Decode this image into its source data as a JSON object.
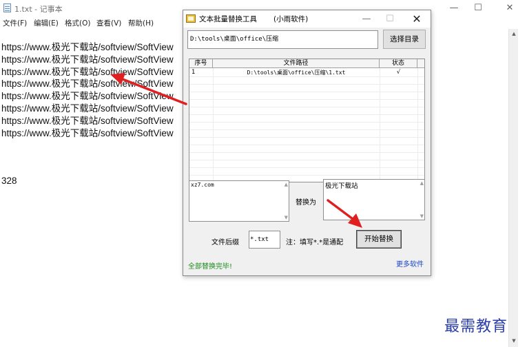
{
  "notepad": {
    "title": "1.txt - 记事本",
    "controls": {
      "minimize": "—",
      "maximize": "☐",
      "close": "✕"
    },
    "menu": [
      "文件(F)",
      "编辑(E)",
      "格式(O)",
      "查看(V)",
      "帮助(H)"
    ],
    "lines": [
      "https://www.极光下载站/softview/SoftView",
      "https://www.极光下载站/softview/SoftView",
      "https://www.极光下载站/softview/SoftView",
      "https://www.极光下载站/softview/SoftView",
      "https://www.极光下载站/softview/SoftView",
      "https://www.极光下载站/softview/SoftView",
      "https://www.极光下载站/softview/SoftView",
      "https://www.极光下载站/softview/SoftView"
    ],
    "trailing_number": "328",
    "scroll": {
      "up": "▲",
      "down": "▼"
    }
  },
  "dialog": {
    "title": "文本批量替换工具",
    "subtitle": "(小雨软件)",
    "controls": {
      "minimize": "—",
      "maximize": "☐",
      "close": "✕"
    },
    "path_value": "D:\\tools\\桌面\\office\\压缩",
    "select_dir_label": "选择目录",
    "table": {
      "headers": [
        "序号",
        "文件路径",
        "状态"
      ],
      "rows": [
        {
          "num": "1",
          "path": "D:\\tools\\桌面\\office\\压缩\\1.txt",
          "status": "√"
        }
      ]
    },
    "find_text": "xz7.com",
    "replace_label": "替换为",
    "replace_text": "极光下载站",
    "scroll": {
      "up": "▲",
      "down": "▼"
    },
    "suffix_label": "文件后缀",
    "suffix_value": "*.txt",
    "suffix_note": "注：填写*.*是通配",
    "start_label": "开始替换",
    "status_text": "全部替换完毕!",
    "more_link": "更多软件"
  },
  "watermark": "最需教育",
  "colors": {
    "arrow": "#e02020",
    "status_green": "#1c8c1c",
    "link_blue": "#1a44c9",
    "watermark_blue": "#2a3da8"
  }
}
